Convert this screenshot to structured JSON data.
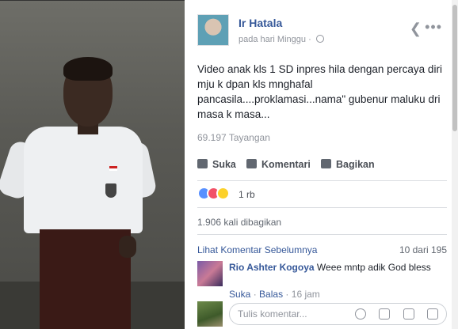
{
  "post": {
    "author": "Ir Hatala",
    "meta_time": "pada hari Minggu",
    "meta_sep": "·",
    "text": "Video anak kls 1 SD inpres hila dengan percaya diri mju k dpan kls mnghafal pancasila....proklamasi...nama\" gubenur maluku dri masa k masa...",
    "views": "69.197 Tayangan",
    "actions": {
      "like": "Suka",
      "comment": "Komentari",
      "share": "Bagikan"
    },
    "reactions": {
      "count": "1 rb",
      "types": [
        "like-icon",
        "love-icon",
        "wow-icon"
      ]
    },
    "shares": "1.906 kali dibagikan"
  },
  "comments": {
    "prev_link": "Lihat Komentar Sebelumnya",
    "count": "10 dari 195",
    "items": [
      {
        "name": "Rio Ashter Kogoya",
        "text": "Weee mntp adik God bless",
        "like": "Suka",
        "sep": "·",
        "reply": "Balas",
        "time": "16 jam"
      }
    ]
  },
  "composer": {
    "placeholder": "Tulis komentar..."
  },
  "icons": {
    "share": "share-arrow-icon",
    "more": "more-options-icon",
    "globe": "globe-icon"
  },
  "colors": {
    "link": "#365899",
    "muted": "#90949c",
    "like": "#5890ff",
    "love": "#f25268",
    "wow": "#fcd12a"
  }
}
